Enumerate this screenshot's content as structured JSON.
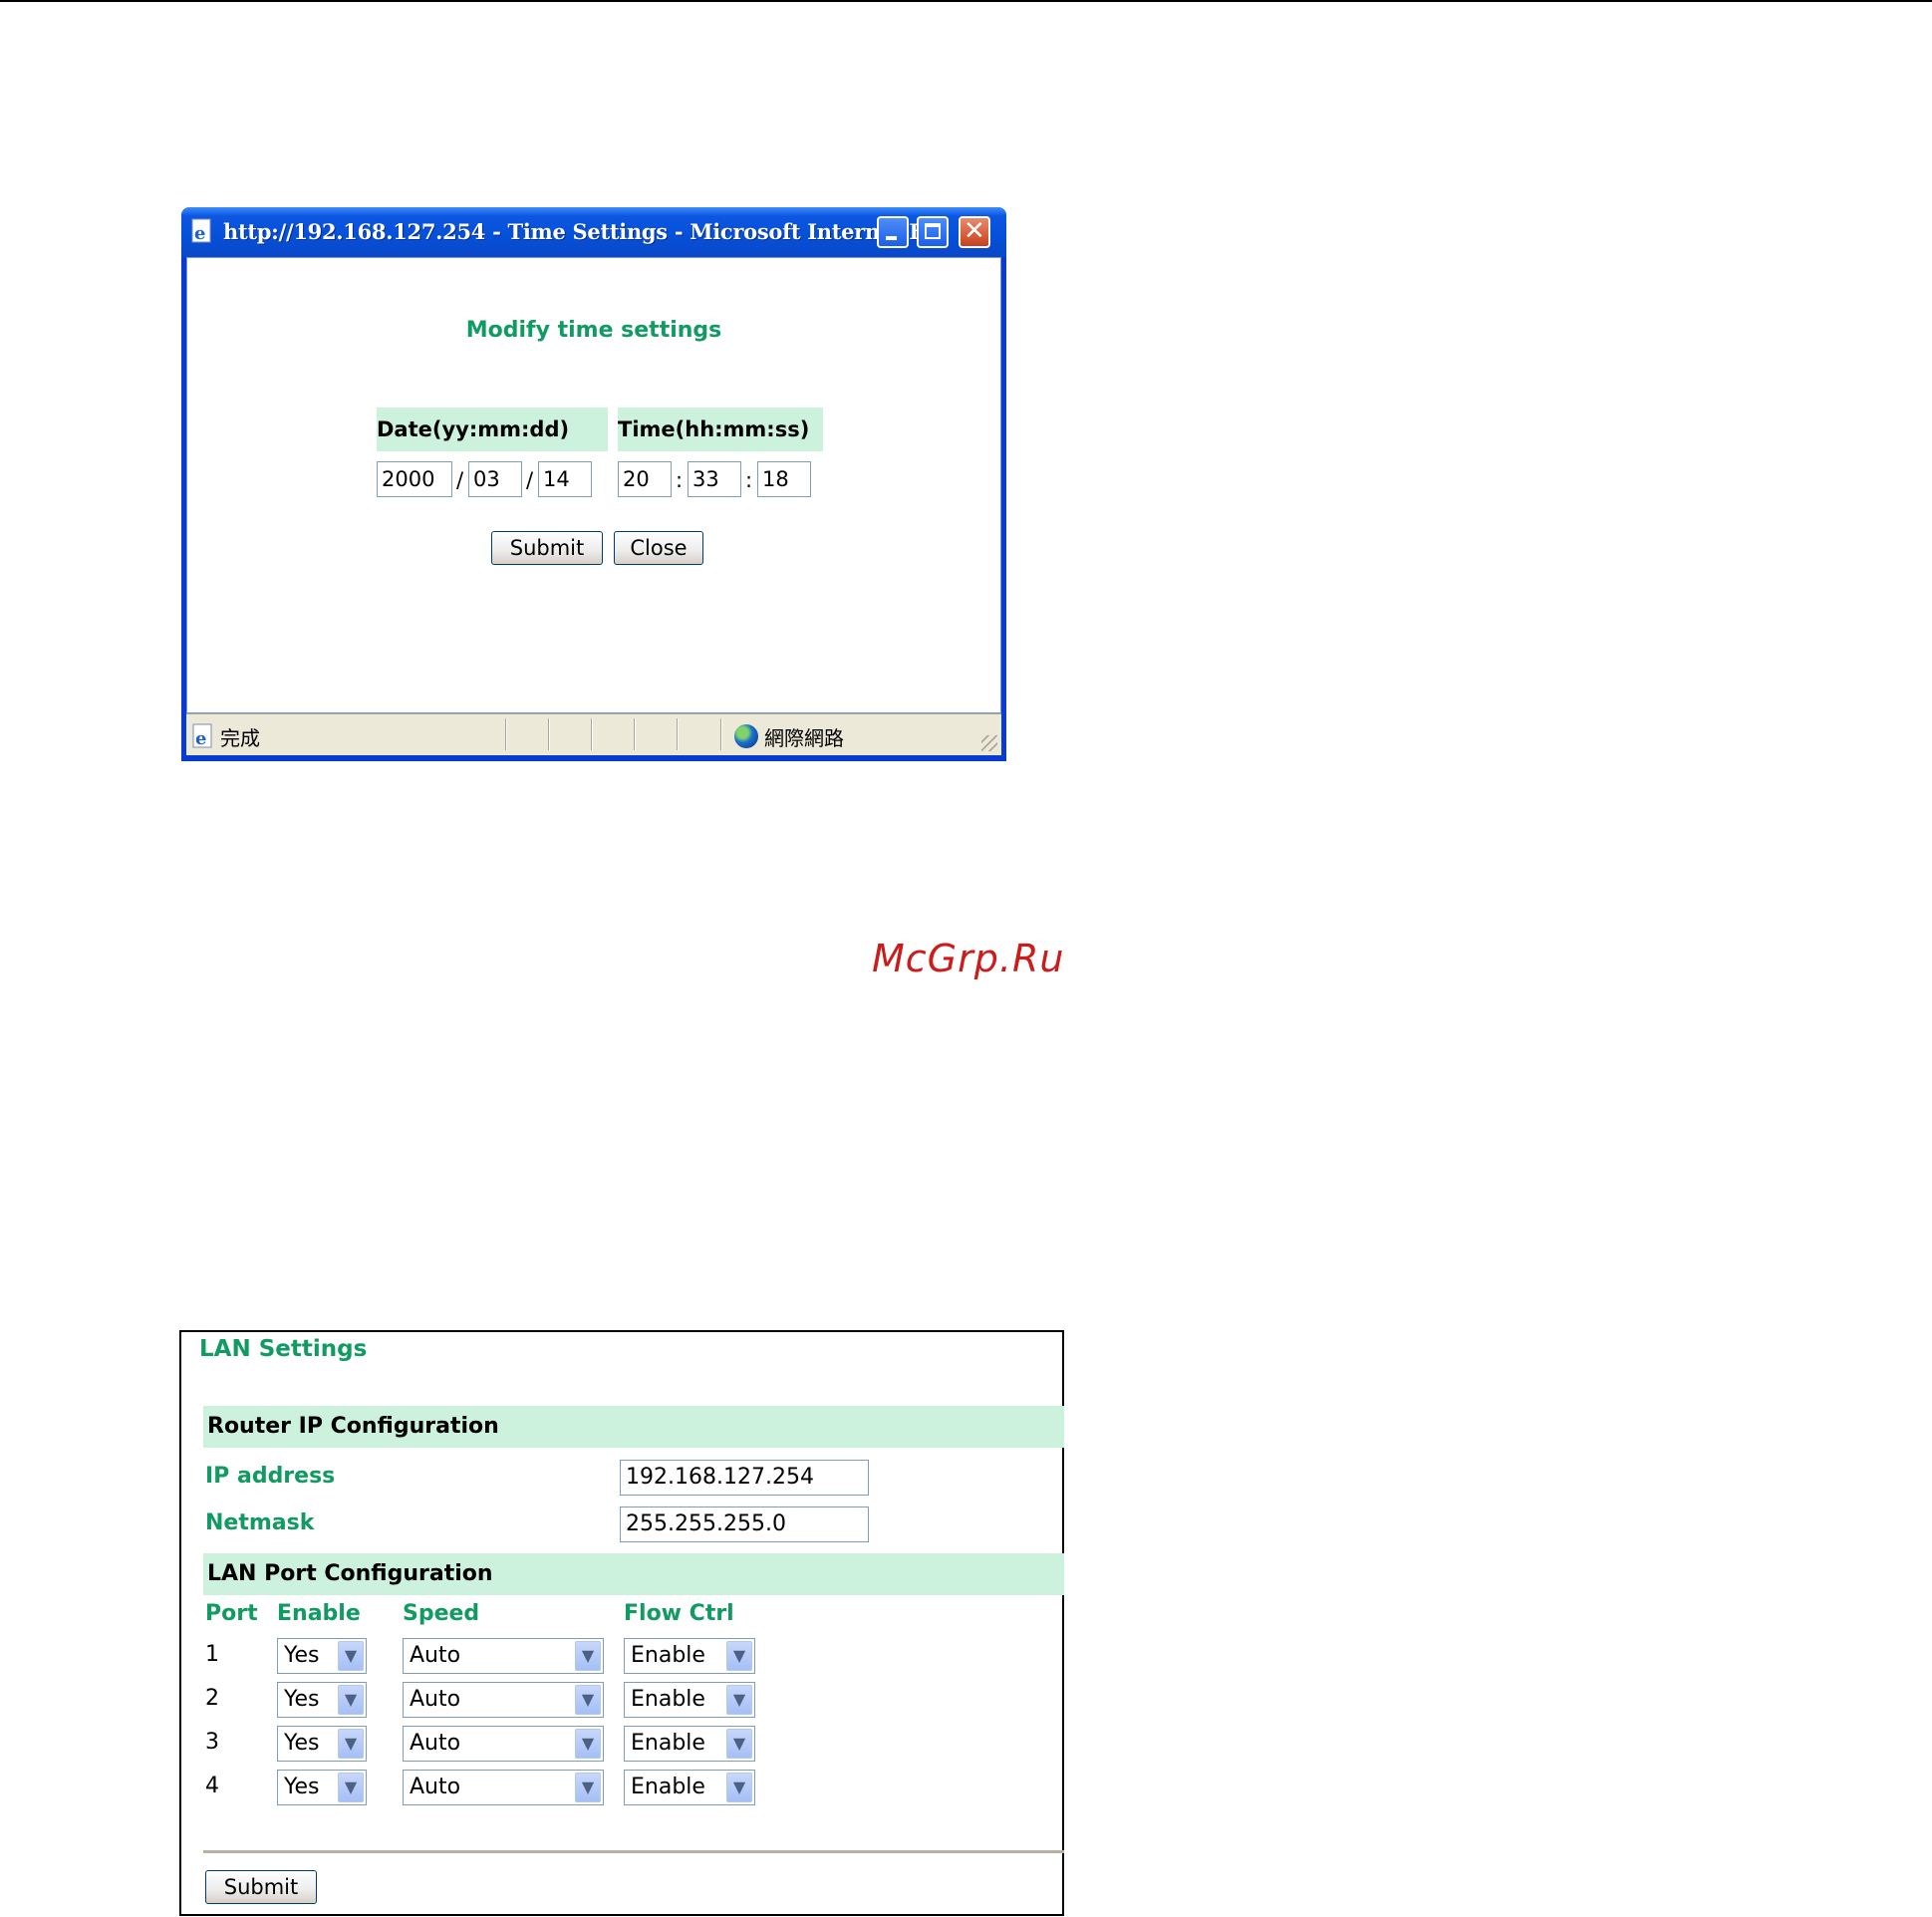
{
  "popup": {
    "window_title": "http://192.168.127.254 - Time Settings - Microsoft Internet E...",
    "heading": "Modify time settings",
    "date_header": "Date(yy:mm:dd)",
    "time_header": "Time(hh:mm:ss)",
    "date": {
      "year": "2000",
      "month": "03",
      "day": "14",
      "separator": "/"
    },
    "time": {
      "hour": "20",
      "minute": "33",
      "second": "18",
      "separator": ":"
    },
    "submit_label": "Submit",
    "close_label": "Close",
    "status_text": "完成",
    "zone_text": "網際網路",
    "accent_color": "#119b62",
    "header_bg": "#ccf2de"
  },
  "watermark": "McGrp.Ru",
  "lan": {
    "title": "LAN Settings",
    "router_section": "Router IP Configuration",
    "ip_label": "IP address",
    "ip_value": "192.168.127.254",
    "netmask_label": "Netmask",
    "netmask_value": "255.255.255.0",
    "port_section": "LAN Port Configuration",
    "columns": {
      "port": "Port",
      "enable": "Enable",
      "speed": "Speed",
      "flow": "Flow Ctrl"
    },
    "ports": [
      {
        "port": "1",
        "enable": "Yes",
        "speed": "Auto",
        "flow": "Enable"
      },
      {
        "port": "2",
        "enable": "Yes",
        "speed": "Auto",
        "flow": "Enable"
      },
      {
        "port": "3",
        "enable": "Yes",
        "speed": "Auto",
        "flow": "Enable"
      },
      {
        "port": "4",
        "enable": "Yes",
        "speed": "Auto",
        "flow": "Enable"
      }
    ],
    "submit_label": "Submit"
  }
}
